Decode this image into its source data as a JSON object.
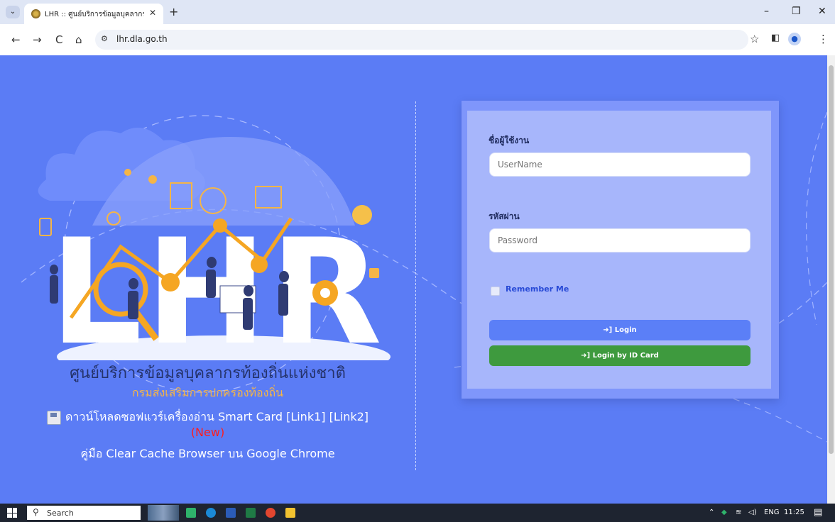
{
  "browser": {
    "tab_title": "LHR :: ศูนย์บริการข้อมูลบุคลากรท้องถิ่นแห่งชาติ",
    "tab_close": "✕",
    "new_tab": "+",
    "url": "lhr.dla.go.th",
    "back": "←",
    "forward": "→",
    "reload": "C",
    "home": "⌂",
    "star": "☆",
    "menu": "⋮",
    "minimize": "–",
    "restore": "❐",
    "close": "✕"
  },
  "caption": {
    "title": "ศูนย์บริการข้อมูลบุคลากรท้องถิ่นแห่งชาติ",
    "subtitle": "กรมส่งเสริมการปกครองท้องถิ่น",
    "download_text": "ดาวน์โหลดซอฟแวร์เครื่องอ่าน Smart Card [Link1] [Link2]",
    "new_label": "(New)",
    "manual_text": "คู่มือ Clear Cache Browser บน Google Chrome"
  },
  "hero": {
    "logo_text": "LHR"
  },
  "login": {
    "username_label": "ชื่อผู้ใช้งาน",
    "username_placeholder": "UserName",
    "password_label": "รหัสผ่าน",
    "password_placeholder": "Password",
    "remember_label": "Remember Me",
    "login_button": "➜] Login",
    "id_card_button": "➜] Login by ID Card"
  },
  "taskbar": {
    "search_placeholder": "Search",
    "language": "ENG",
    "time": "11:25"
  },
  "colors": {
    "page_bg": "#5b7cf5",
    "login_button": "#5b7ff7",
    "id_card_button": "#3e9a3e",
    "subtitle": "#f5b547",
    "new_label": "#ff1d1d"
  }
}
